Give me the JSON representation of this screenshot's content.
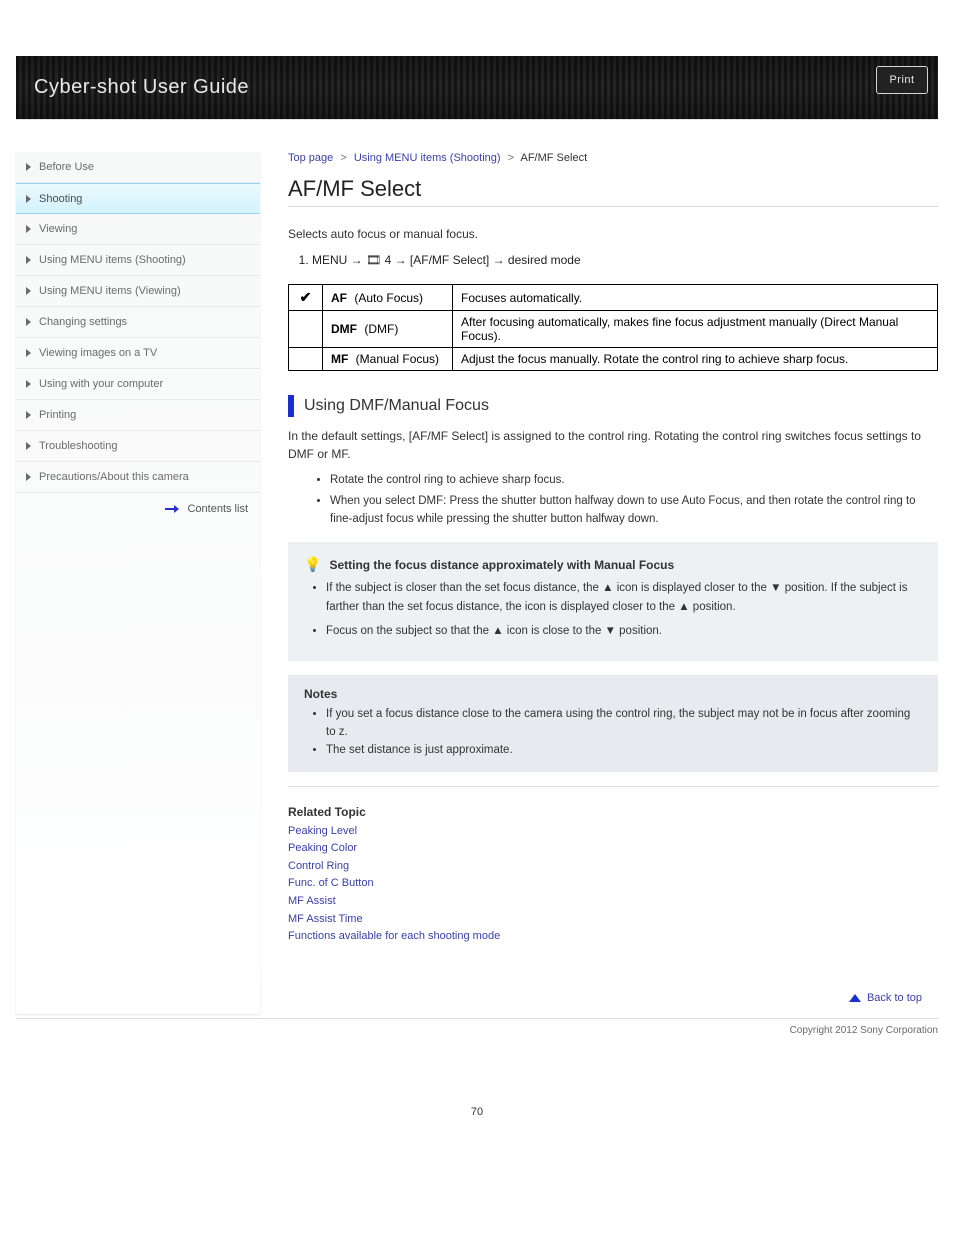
{
  "banner": {
    "title": "Cyber-shot User Guide",
    "print_label": "Print"
  },
  "breadcrumb": {
    "a": "Top page",
    "b": "Using MENU items (Shooting)",
    "c": "AF/MF Select"
  },
  "title": "AF/MF Select",
  "intro": "Selects auto focus or manual focus.",
  "steps": [
    "MENU → 🎞 4 → [AF/MF Select] → desired mode"
  ],
  "opts": {
    "rows": [
      {
        "check": "✔",
        "icon": "AF",
        "label": "(Auto Focus)",
        "desc": "Focuses automatically."
      },
      {
        "check": "",
        "icon": "DMF",
        "label": "(DMF)",
        "desc": "After focusing automatically, makes fine focus adjustment manually (Direct Manual Focus)."
      },
      {
        "check": "",
        "icon": "MF",
        "label": "(Manual Focus)",
        "desc": "Adjust the focus manually. Rotate the control ring to achieve sharp focus."
      }
    ]
  },
  "sub1": {
    "heading": "Using DMF/Manual Focus",
    "line": "In the default settings, [AF/MF Select] is assigned to the control ring. Rotating the control ring switches focus settings to DMF or MF.",
    "bullets": [
      "Rotate the control ring to achieve sharp focus.",
      "When you select DMF: Press the shutter button halfway down to use Auto Focus, and then rotate the control ring to fine-adjust focus while pressing the shutter button halfway down."
    ]
  },
  "hint": {
    "title": "Setting the focus distance approximately with Manual Focus",
    "bullets": [
      "If the subject is closer than the set focus distance, the ▲ icon is displayed closer to the ▼ position. If the subject is farther than the set focus distance, the icon is displayed closer to the ▲ position.",
      "Focus on the subject so that the ▲ icon is close to the ▼ position."
    ]
  },
  "notes": {
    "title": "Notes",
    "bullets": [
      "If you set a focus distance close to the camera using the control ring, the subject may not be in focus after zooming to z.",
      "The set distance is just approximate."
    ]
  },
  "related": {
    "heading": "Related Topic",
    "items": [
      "Peaking Level",
      "Peaking Color",
      "Control Ring",
      "Func. of C Button",
      "MF Assist",
      "MF Assist Time",
      "Functions available for each shooting mode"
    ]
  },
  "sidebar": {
    "items": [
      {
        "label": "Before Use",
        "active": false
      },
      {
        "label": "Shooting",
        "active": true
      },
      {
        "label": "Viewing",
        "active": false
      },
      {
        "label": "Using MENU items (Shooting)",
        "active": false
      },
      {
        "label": "Using MENU items (Viewing)",
        "active": false
      },
      {
        "label": "Changing settings",
        "active": false
      },
      {
        "label": "Viewing images on a TV",
        "active": false
      },
      {
        "label": "Using with your computer",
        "active": false
      },
      {
        "label": "Printing",
        "active": false
      },
      {
        "label": "Troubleshooting",
        "active": false
      },
      {
        "label": "Precautions/About this camera",
        "active": false
      }
    ],
    "toc_label": "Contents list"
  },
  "back_to_top": "Back to top",
  "copyright": "Copyright 2012 Sony Corporation",
  "page_number": "70"
}
